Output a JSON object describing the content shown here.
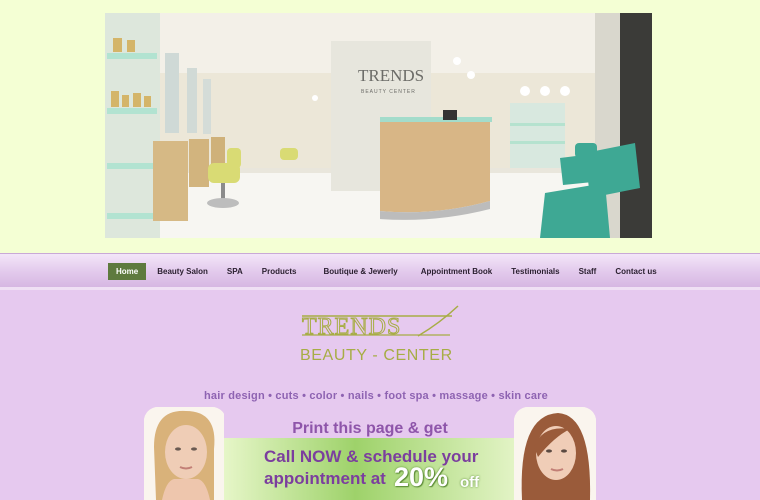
{
  "logo": {
    "line1": "TRENDS",
    "line2": "BEAUTY - CENTER"
  },
  "hero": {
    "sign_line1": "TRENDS",
    "sign_line2": "BEAUTY CENTER"
  },
  "nav": {
    "items": [
      {
        "label": "Home",
        "active": true
      },
      {
        "label": "Beauty Salon"
      },
      {
        "label": "SPA"
      },
      {
        "label": "Products"
      },
      {
        "label": "Boutique & Jewerly"
      },
      {
        "label": "Appointment Book"
      },
      {
        "label": "Testimonials"
      },
      {
        "label": "Staff"
      },
      {
        "label": "Contact us"
      }
    ]
  },
  "services": "hair design  •  cuts  •  color  •  nails  •  foot spa  •  massage  •  skin care",
  "promo": {
    "heading": "Print this page & get",
    "line1": "Call NOW & schedule your",
    "line2": "appointment at",
    "percent": "20%",
    "off": "off"
  },
  "colors": {
    "page_bg": "#f4ffd4",
    "nav_active": "#5e7a3e",
    "main_bg": "#e6c9ef",
    "logo": "#a7ad45",
    "accent_purple": "#8e55aa"
  }
}
